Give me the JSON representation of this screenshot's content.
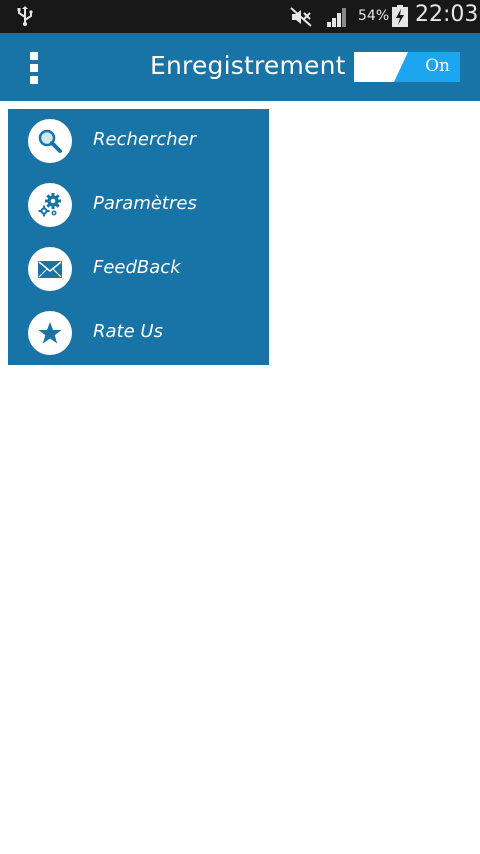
{
  "status_bar": {
    "battery_percent": "54%",
    "time": "22:03",
    "icons": [
      "usb-icon",
      "mute-icon",
      "signal-icon",
      "battery-charging-icon"
    ]
  },
  "app_bar": {
    "title": "Enregistrement",
    "toggle_label": "On",
    "toggle_state": "on",
    "menu_icon": "overflow-menu-icon"
  },
  "menu": {
    "items": [
      {
        "label": "Rechercher",
        "icon": "search-icon"
      },
      {
        "label": "Paramètres",
        "icon": "gears-icon"
      },
      {
        "label": "FeedBack",
        "icon": "envelope-icon"
      },
      {
        "label": "Rate Us",
        "icon": "star-icon"
      }
    ]
  },
  "colors": {
    "primary": "#1874a6",
    "toggle_accent": "#1da6f0",
    "status_bar": "#181818",
    "background": "#ffffff"
  }
}
